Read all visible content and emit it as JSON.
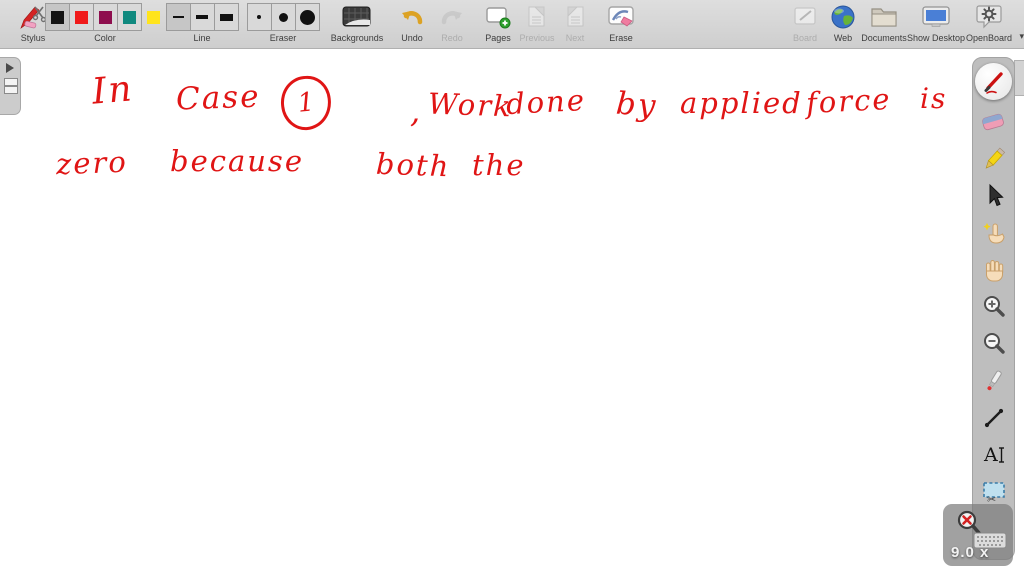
{
  "toolbar": {
    "stylus": {
      "label": "Stylus"
    },
    "color": {
      "label": "Color",
      "swatches": [
        {
          "name": "black",
          "hex": "#141414",
          "selected": true
        },
        {
          "name": "red",
          "hex": "#f01a1a",
          "selected": false
        },
        {
          "name": "maroon",
          "hex": "#8e0e4e",
          "selected": false
        },
        {
          "name": "teal",
          "hex": "#10897f",
          "selected": false
        },
        {
          "name": "yellow",
          "hex": "#ffe41c",
          "selected": false
        }
      ]
    },
    "line": {
      "label": "Line",
      "options": [
        "thin",
        "medium",
        "thick"
      ],
      "selected": "thin"
    },
    "eraser": {
      "label": "Eraser",
      "options": [
        "small",
        "medium",
        "large"
      ]
    },
    "backgrounds": {
      "label": "Backgrounds",
      "enabled": true
    },
    "undo": {
      "label": "Undo",
      "enabled": true
    },
    "redo": {
      "label": "Redo",
      "enabled": false
    },
    "pages": {
      "label": "Pages",
      "enabled": true
    },
    "previous": {
      "label": "Previous",
      "enabled": false
    },
    "next": {
      "label": "Next",
      "enabled": false
    },
    "erase": {
      "label": "Erase",
      "enabled": true
    },
    "board": {
      "label": "Board",
      "enabled": false
    },
    "web": {
      "label": "Web",
      "enabled": true
    },
    "documents": {
      "label": "Documents",
      "enabled": true
    },
    "show_desktop": {
      "label": "Show Desktop",
      "enabled": true
    },
    "openboard": {
      "label": "OpenBoard",
      "enabled": true,
      "caret": "▾"
    }
  },
  "canvas": {
    "ink_color": "#e01515",
    "transcript": [
      "In Case (1) , Work done by applied force is",
      "zero because both the"
    ],
    "words": [
      "In",
      "Case",
      "1",
      ",",
      "Work",
      "done",
      "by",
      "applied",
      "force",
      "is",
      "zero",
      "because",
      "both",
      "the"
    ]
  },
  "right_toolbar": {
    "tools": [
      "pen",
      "eraser",
      "marker",
      "selector",
      "play",
      "hand",
      "zoom-in",
      "zoom-out",
      "laser-pointer",
      "line",
      "text",
      "capture"
    ],
    "selected_tool": "pen"
  },
  "zoom_widget": {
    "zoom_label": "9.0 x"
  }
}
